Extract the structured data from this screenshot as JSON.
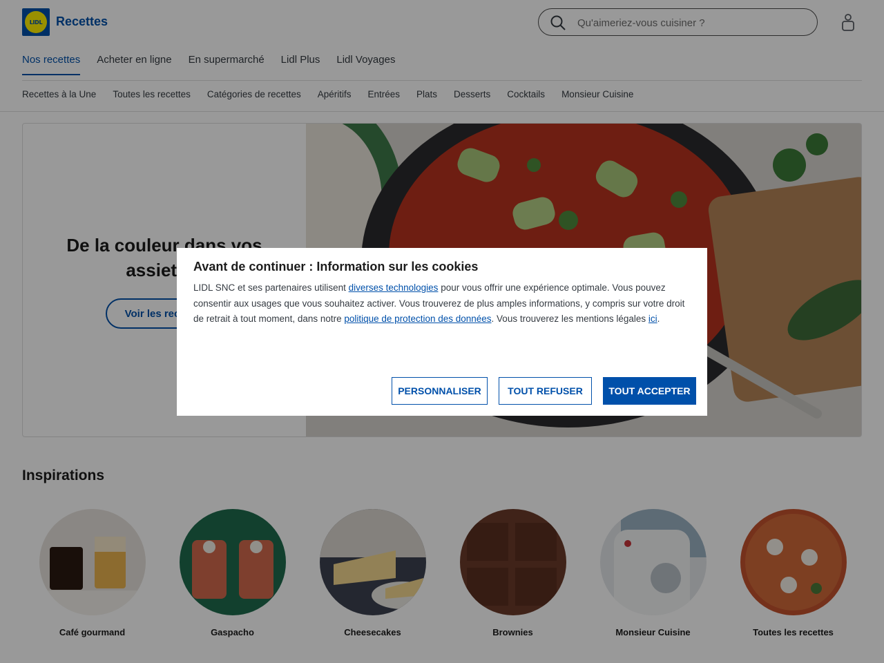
{
  "brand": {
    "logo_text": "LIDL",
    "title": "Recettes"
  },
  "search": {
    "placeholder": "Qu'aimeriez-vous cuisiner ?"
  },
  "main_nav": [
    {
      "label": "Nos recettes",
      "active": true
    },
    {
      "label": "Acheter en ligne"
    },
    {
      "label": "En supermarché"
    },
    {
      "label": "Lidl Plus"
    },
    {
      "label": "Lidl Voyages"
    }
  ],
  "sub_nav": [
    {
      "label": "Recettes à la Une"
    },
    {
      "label": "Toutes les recettes"
    },
    {
      "label": "Catégories de recettes"
    },
    {
      "label": "Apéritifs"
    },
    {
      "label": "Entrées"
    },
    {
      "label": "Plats"
    },
    {
      "label": "Desserts"
    },
    {
      "label": "Cocktails"
    },
    {
      "label": "Monsieur Cuisine"
    }
  ],
  "hero": {
    "title": "De la couleur dans vos assiettes",
    "button": "Voir les recettes"
  },
  "inspirations": {
    "title": "Inspirations",
    "items": [
      {
        "label": "Café gourmand"
      },
      {
        "label": "Gaspacho"
      },
      {
        "label": "Cheesecakes"
      },
      {
        "label": "Brownies"
      },
      {
        "label": "Monsieur Cuisine"
      },
      {
        "label": "Toutes les recettes"
      }
    ]
  },
  "cookie_dialog": {
    "title": "Avant de continuer : Information sur les cookies",
    "text_1": "LIDL SNC et ses partenaires utilisent ",
    "link_1": "diverses technologies",
    "text_2": " pour vous offrir une expérience optimale. Vous pouvez consentir aux usages que vous souhaitez activer. Vous trouverez de plus amples informations, y compris sur votre droit de retrait à tout moment, dans notre ",
    "link_2": "politique de protection des données",
    "text_3": ". Vous trouverez les mentions légales ",
    "link_3": "ici",
    "text_4": ".",
    "btn_customize": "PERSONNALISER",
    "btn_refuse": "TOUT REFUSER",
    "btn_accept": "TOUT ACCEPTER"
  },
  "colors": {
    "brand_blue": "#0050aa",
    "brand_yellow": "#fff000",
    "overlay": "rgba(0,0,0,0.4)"
  }
}
